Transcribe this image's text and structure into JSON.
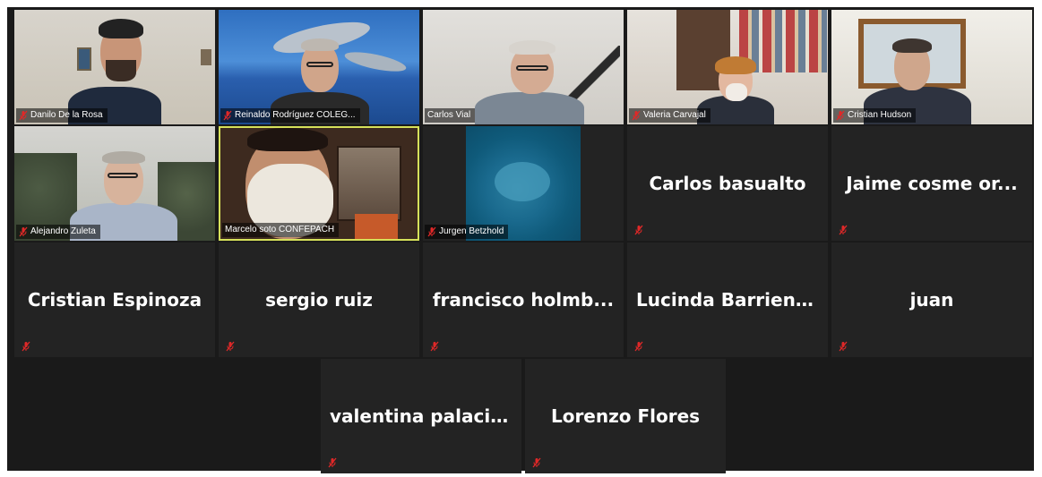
{
  "participants": [
    {
      "name": "Danilo De la Rosa"
    },
    {
      "name": "Reinaldo Rodríguez  COLEG..."
    },
    {
      "name": "Carlos Vial"
    },
    {
      "name": "Valeria Carvajal"
    },
    {
      "name": "Cristian Hudson"
    },
    {
      "name": "Alejandro Zuleta"
    },
    {
      "name": "Marcelo soto CONFEPACH"
    },
    {
      "name": "Jurgen Betzhold"
    },
    {
      "name": "Carlos basualto"
    },
    {
      "name": "Jaime cosme or..."
    },
    {
      "name": "Cristian Espinoza"
    },
    {
      "name": "sergio ruiz"
    },
    {
      "name": "francisco  holmb..."
    },
    {
      "name": "Lucinda Barrientos"
    },
    {
      "name": "juan"
    },
    {
      "name": "valentina palacios"
    },
    {
      "name": "Lorenzo Flores"
    }
  ],
  "colors": {
    "background": "#1a1a1a",
    "tile": "#232323",
    "active_speaker_border": "#d6e15a",
    "muted_icon": "#e02828"
  },
  "icons": {
    "muted": "microphone-muted-icon"
  }
}
